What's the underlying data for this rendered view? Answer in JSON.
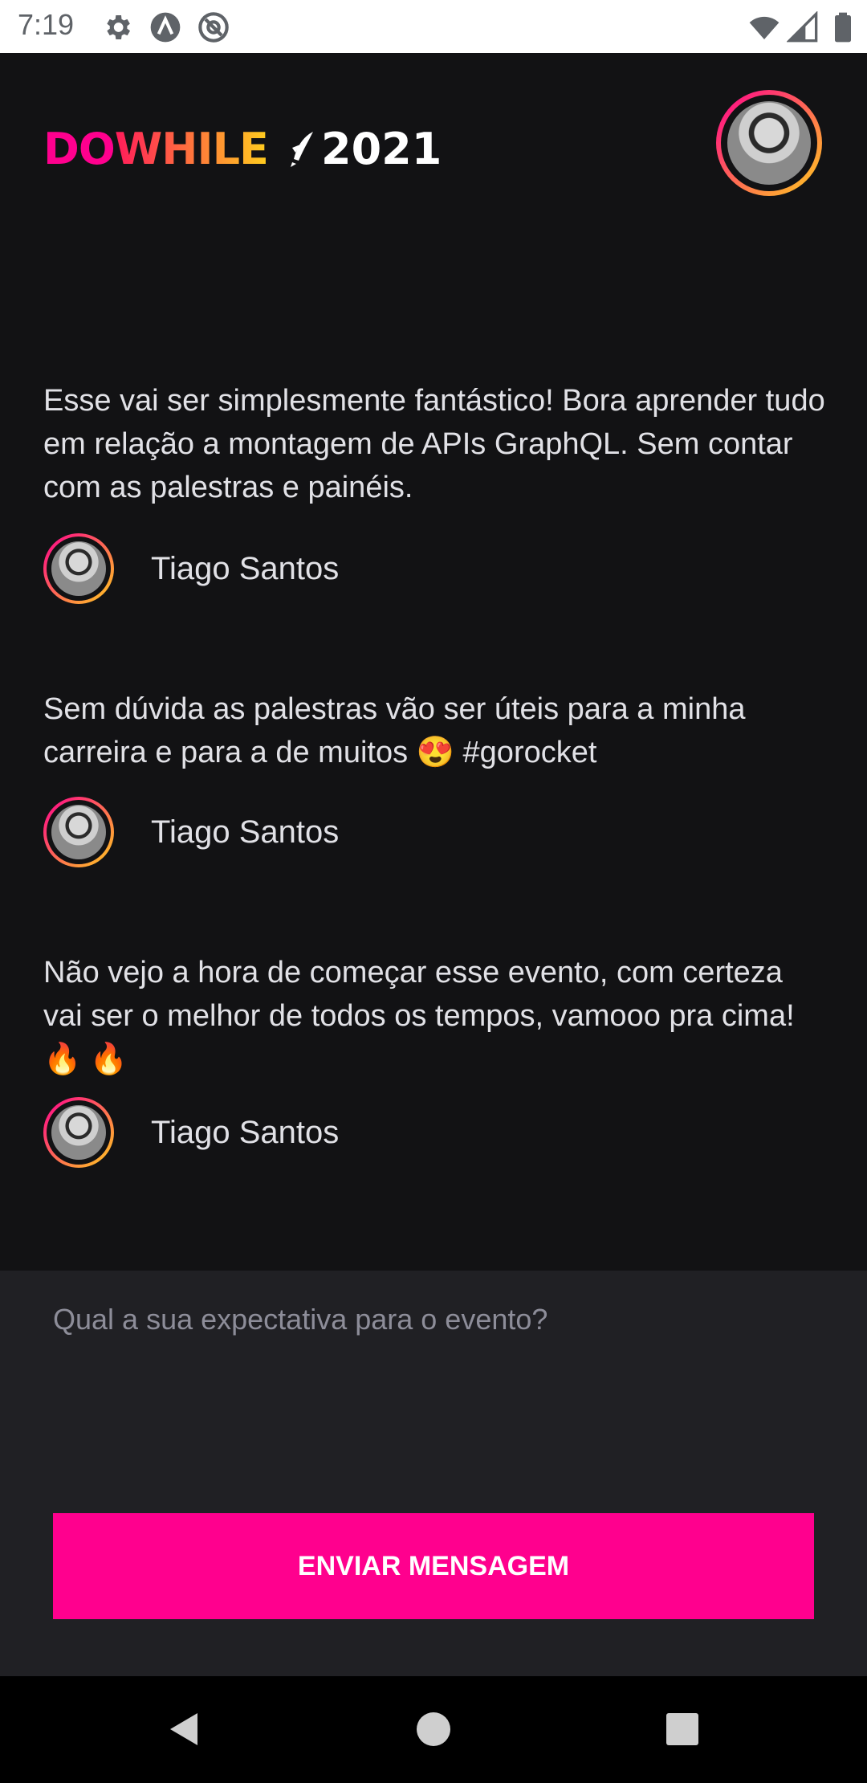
{
  "status_bar": {
    "time": "7:19",
    "icons": [
      "gear-icon",
      "app-a-icon",
      "at-icon",
      "wifi-icon",
      "cell-signal-icon",
      "battery-icon"
    ]
  },
  "header": {
    "logo": {
      "do": "DO",
      "while": "WHILE",
      "year": "2021"
    },
    "profile_icon": "avatar"
  },
  "messages": [
    {
      "text": "Esse vai ser simplesmente fantástico! Bora aprender tudo em relação a montagem de APIs GraphQL. Sem contar com as palestras e painéis.",
      "author": "Tiago Santos"
    },
    {
      "text": "Sem dúvida as palestras vão ser úteis para a minha carreira e para a de muitos 😍 #gorocket",
      "author": "Tiago Santos"
    },
    {
      "text": "Não vejo a hora de começar esse evento, com certeza vai ser o melhor de todos os tempos, vamooo pra cima! 🔥 🔥",
      "author": "Tiago Santos"
    }
  ],
  "composer": {
    "placeholder": "Qual a sua expectativa para o evento?",
    "value": "",
    "send_label": "ENVIAR MENSAGEM"
  },
  "nav": {
    "icons": [
      "back-icon",
      "home-icon",
      "recents-icon"
    ]
  },
  "colors": {
    "background": "#121214",
    "footer": "#202024",
    "accent": "#FF008E",
    "gradient_start": "#FF008E",
    "gradient_end": "#FFCD1E"
  }
}
